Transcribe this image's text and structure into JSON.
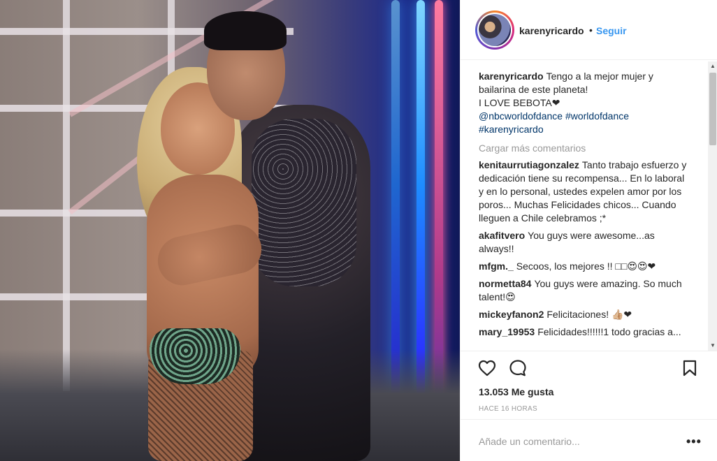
{
  "header": {
    "username": "karenyricardo",
    "separator": "•",
    "follow_label": "Seguir"
  },
  "caption": {
    "username": "karenyricardo",
    "text": "Tengo a la mejor mujer y bailarina de este planeta!\nI LOVE BEBOTA",
    "heart": "❤",
    "tags": [
      "@nbcworldofdance",
      "#worldofdance",
      "#karenyricardo"
    ]
  },
  "load_more_label": "Cargar más comentarios",
  "comments": [
    {
      "username": "kenitaurrutiagonzalez",
      "text": "Tanto trabajo esfuerzo y dedicación tiene su recompensa... En lo laboral y en lo personal, ustedes expelen amor por los poros... Muchas Felicidades chicos... Cuando lleguen a Chile celebramos ;*"
    },
    {
      "username": "akafitvero",
      "text": "You guys were awesome...as always!!"
    },
    {
      "username": "mfgm._",
      "text": "Secoos, los mejores !! □□😍😍❤"
    },
    {
      "username": "normetta84",
      "text": "You guys were amazing. So much talent!😍"
    },
    {
      "username": "mickeyfanon2",
      "text": "Felicitaciones! 👍🏼❤"
    },
    {
      "username": "mary_19953",
      "text": "Felicidades!!!!!!1 todo gracias a..."
    }
  ],
  "likes_text": "13.053 Me gusta",
  "time_text": "HACE 16 HORAS",
  "add_comment_placeholder": "Añade un comentario...",
  "more_options_label": "•••",
  "icons": {
    "like": "heart-outline-icon",
    "comment": "speech-bubble-icon",
    "save": "bookmark-icon",
    "more": "ellipsis-icon"
  },
  "colors": {
    "link_blue": "#3897f0",
    "tag_blue": "#003569",
    "muted_grey": "#999999",
    "text": "#262626"
  }
}
